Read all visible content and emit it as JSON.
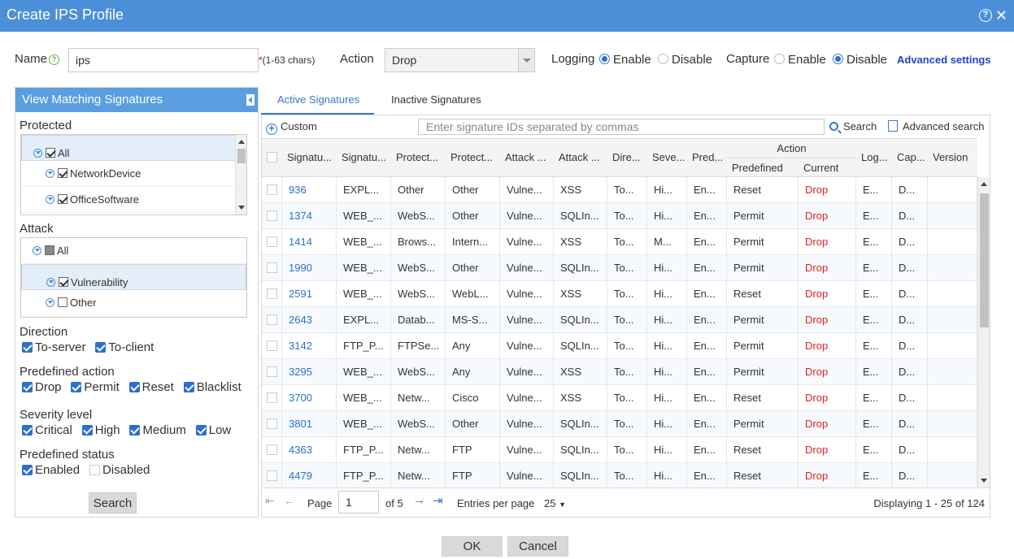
{
  "dialog": {
    "title": "Create IPS Profile",
    "help_icon": "help-icon",
    "close_icon": "close-icon"
  },
  "form": {
    "name_label": "Name",
    "name_value": "ips",
    "name_required_star": "*",
    "name_hint": "(1-63 chars)",
    "action_label": "Action",
    "action_value": "Drop",
    "logging_label": "Logging",
    "logging_enable": "Enable",
    "logging_disable": "Disable",
    "logging_selected": "Enable",
    "capture_label": "Capture",
    "capture_enable": "Enable",
    "capture_disable": "Disable",
    "capture_selected": "Disable",
    "advanced_settings": "Advanced settings"
  },
  "filter": {
    "header": "View Matching Signatures",
    "protected": {
      "label": "Protected",
      "items": [
        "All",
        "NetworkDevice",
        "OfficeSoftware"
      ]
    },
    "attack": {
      "label": "Attack",
      "items": [
        "All",
        "Vulnerability",
        "Other"
      ]
    },
    "direction": {
      "label": "Direction",
      "options": [
        "To-server",
        "To-client"
      ]
    },
    "predefined_action": {
      "label": "Predefined action",
      "options": [
        "Drop",
        "Permit",
        "Reset",
        "Blacklist"
      ]
    },
    "severity": {
      "label": "Severity level",
      "options": [
        "Critical",
        "High",
        "Medium",
        "Low"
      ]
    },
    "predefined_status": {
      "label": "Predefined status",
      "enabled": "Enabled",
      "disabled": "Disabled"
    },
    "search_button": "Search"
  },
  "tabs": [
    "Active Signatures",
    "Inactive Signatures"
  ],
  "toolbar": {
    "custom": "Custom",
    "search_placeholder": "Enter signature IDs separated by commas",
    "search": "Search",
    "advanced_search": "Advanced search"
  },
  "table": {
    "headers": [
      "Signatu...",
      "Signatu...",
      "Protect...",
      "Protect...",
      "Attack ...",
      "Attack ...",
      "Dire...",
      "Seve...",
      "Pred...",
      "Log...",
      "Cap...",
      "Version"
    ],
    "action_group": "Action",
    "action_sub": [
      "Predefined",
      "Current"
    ],
    "rows": [
      [
        "936",
        "EXPL...",
        "Other",
        "Other",
        "Vulne...",
        "XSS",
        "To...",
        "Hi...",
        "En...",
        "Reset",
        "Drop",
        "E...",
        "D...",
        ""
      ],
      [
        "1374",
        "WEB_...",
        "WebS...",
        "Other",
        "Vulne...",
        "SQLIn...",
        "To...",
        "Hi...",
        "En...",
        "Permit",
        "Drop",
        "E...",
        "D...",
        ""
      ],
      [
        "1414",
        "WEB_...",
        "Brows...",
        "Intern...",
        "Vulne...",
        "XSS",
        "To...",
        "M...",
        "En...",
        "Permit",
        "Drop",
        "E...",
        "D...",
        ""
      ],
      [
        "1990",
        "WEB_...",
        "WebS...",
        "Other",
        "Vulne...",
        "SQLIn...",
        "To...",
        "Hi...",
        "En...",
        "Permit",
        "Drop",
        "E...",
        "D...",
        ""
      ],
      [
        "2591",
        "WEB_...",
        "WebS...",
        "WebL...",
        "Vulne...",
        "XSS",
        "To...",
        "Hi...",
        "En...",
        "Reset",
        "Drop",
        "E...",
        "D...",
        ""
      ],
      [
        "2643",
        "EXPL...",
        "Datab...",
        "MS-S...",
        "Vulne...",
        "SQLIn...",
        "To...",
        "Hi...",
        "En...",
        "Permit",
        "Drop",
        "E...",
        "D...",
        ""
      ],
      [
        "3142",
        "FTP_P...",
        "FTPSe...",
        "Any",
        "Vulne...",
        "SQLIn...",
        "To...",
        "Hi...",
        "En...",
        "Permit",
        "Drop",
        "E...",
        "D...",
        ""
      ],
      [
        "3295",
        "WEB_...",
        "WebS...",
        "Any",
        "Vulne...",
        "XSS",
        "To...",
        "Hi...",
        "En...",
        "Permit",
        "Drop",
        "E...",
        "D...",
        ""
      ],
      [
        "3700",
        "WEB_...",
        "Netw...",
        "Cisco",
        "Vulne...",
        "XSS",
        "To...",
        "Hi...",
        "En...",
        "Reset",
        "Drop",
        "E...",
        "D...",
        ""
      ],
      [
        "3801",
        "WEB_...",
        "WebS...",
        "Other",
        "Vulne...",
        "SQLIn...",
        "To...",
        "Hi...",
        "En...",
        "Permit",
        "Drop",
        "E...",
        "D...",
        ""
      ],
      [
        "4363",
        "FTP_P...",
        "Netw...",
        "FTP",
        "Vulne...",
        "SQLIn...",
        "To...",
        "Hi...",
        "En...",
        "Reset",
        "Drop",
        "E...",
        "D...",
        ""
      ],
      [
        "4479",
        "FTP_P...",
        "Netw...",
        "FTP",
        "Vulne...",
        "SQLIn...",
        "To...",
        "Hi...",
        "En...",
        "Reset",
        "Drop",
        "E...",
        "D...",
        ""
      ]
    ]
  },
  "pager": {
    "page_label": "Page",
    "page_value": "1",
    "of_label": "of 5",
    "entries_label": "Entries per page",
    "entries_value": "25",
    "displaying": "Displaying 1 - 25 of 124"
  },
  "footer": {
    "ok": "OK",
    "cancel": "Cancel"
  },
  "colors": {
    "title_bar": "#4a8fd8",
    "accent": "#2b6fd1",
    "drop_red": "#e0221e"
  }
}
